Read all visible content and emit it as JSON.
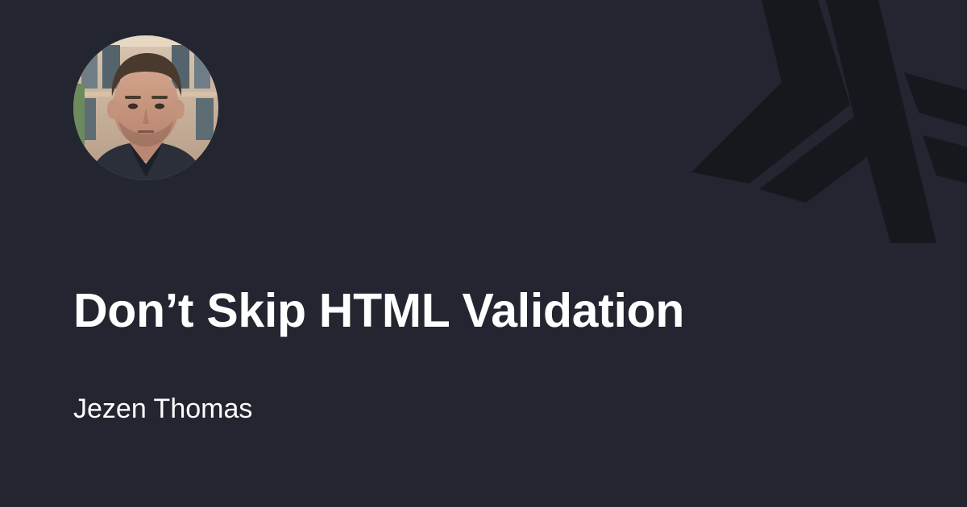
{
  "post": {
    "title": "Don’t Skip HTML Validation",
    "author": "Jezen Thomas"
  },
  "avatar": {
    "icon": "author-portrait"
  },
  "logo": {
    "icon": "haskell-logo-icon"
  },
  "colors": {
    "background": "#232530",
    "logo": "#17181e",
    "text": "#ffffff"
  }
}
